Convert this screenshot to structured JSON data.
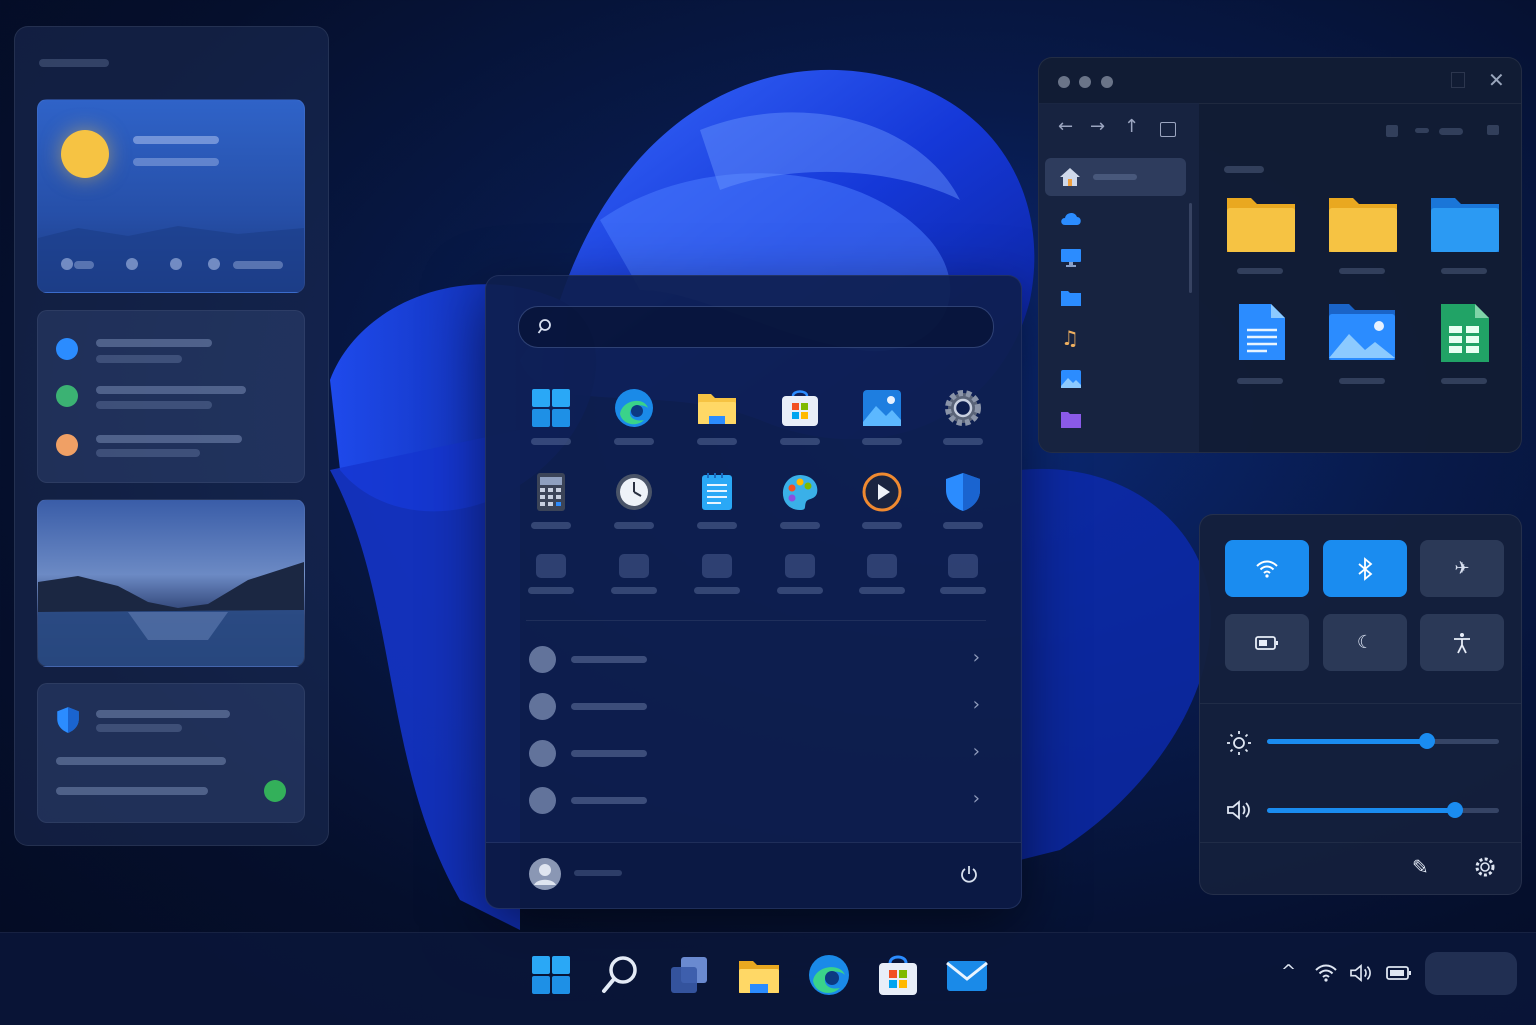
{
  "theme": {
    "accent": "#1a8cf0",
    "folder_yellow": "#f6c343",
    "folder_blue": "#2b9af3"
  },
  "widgets": {
    "cards": [
      "weather-card",
      "tasks-card",
      "photo-card",
      "security-card"
    ],
    "task_dot_colors": [
      "#2b8cff",
      "#3bb273",
      "#f0a065"
    ],
    "security_status_color": "#33b05a"
  },
  "start_menu": {
    "search": {
      "placeholder": ""
    },
    "pinned_apps": [
      "start-icon",
      "edge-icon",
      "file-explorer-icon",
      "store-icon",
      "photos-icon",
      "settings-gear-icon",
      "calculator-icon",
      "clock-icon",
      "notepad-icon",
      "paint-icon",
      "media-player-icon",
      "security-shield-icon"
    ],
    "recommended_count_icons": [
      "chevron-right-icon",
      "chevron-right-icon",
      "chevron-right-icon",
      "chevron-right-icon"
    ],
    "footer": {
      "user_icon": "user-avatar-icon",
      "power_icon": "power-icon"
    }
  },
  "file_explorer": {
    "window_controls": [
      "minimize-dot",
      "maximize-dot",
      "close-dot",
      "close-icon"
    ],
    "nav_icons": [
      "back-arrow-icon",
      "forward-arrow-icon",
      "up-arrow-icon",
      "view-square-icon"
    ],
    "sidebar_icons": [
      "home-icon",
      "cloud-icon",
      "desktop-icon",
      "folder-icon",
      "music-icon",
      "pictures-icon",
      "purple-folder-icon"
    ],
    "files": [
      "folder-yellow-icon",
      "folder-yellow-icon",
      "folder-blue-icon",
      "document-icon",
      "image-icon",
      "spreadsheet-icon"
    ]
  },
  "quick_settings": {
    "tiles": [
      {
        "name": "wifi",
        "on": true
      },
      {
        "name": "bluetooth",
        "on": true
      },
      {
        "name": "airplane-mode",
        "on": false
      },
      {
        "name": "battery-saver",
        "on": false
      },
      {
        "name": "night-light",
        "on": false
      },
      {
        "name": "accessibility",
        "on": false
      }
    ],
    "brightness": 0.69,
    "volume": 0.81
  },
  "taskbar": {
    "apps": [
      "start-button",
      "search-button",
      "task-view-button",
      "file-explorer-button",
      "edge-button",
      "store-button",
      "mail-button"
    ],
    "tray": [
      "chevron-up-icon",
      "wifi-icon",
      "volume-icon",
      "battery-icon"
    ]
  }
}
